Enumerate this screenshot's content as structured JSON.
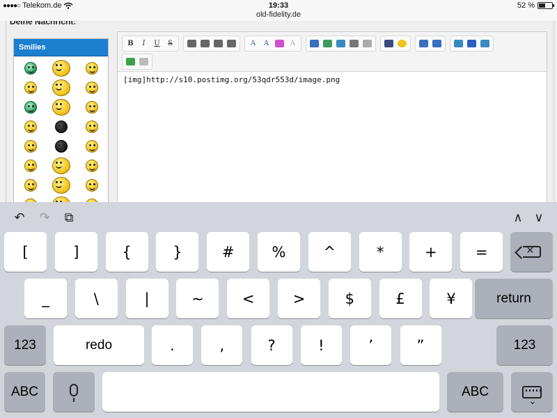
{
  "status_bar": {
    "carrier": "Telekom.de",
    "signal_dots": "●●●●○",
    "time": "19:33",
    "url": "old-fidelity.de",
    "battery_text": "52 %",
    "battery_level": 0.52
  },
  "page": {
    "section_title": "Deine Nachricht:",
    "smilies_title": "Smilies",
    "smilies_count": 24,
    "editor_content": "[img]http://s10.postimg.org/53qdr553d/image.png",
    "toolbar_row1_groups": [
      [
        {
          "label": "B",
          "name": "bold-button"
        },
        {
          "label": "I",
          "name": "italic-button"
        },
        {
          "label": "U",
          "name": "underline-button"
        },
        {
          "label": "S",
          "name": "strikethrough-button"
        }
      ],
      [
        {
          "label": "",
          "name": "align-left-icon"
        },
        {
          "label": "",
          "name": "align-center-icon"
        },
        {
          "label": "",
          "name": "align-right-icon"
        },
        {
          "label": "",
          "name": "align-justify-icon"
        }
      ],
      [
        {
          "label": "A",
          "name": "font-icon"
        },
        {
          "label": "A",
          "name": "font-size-icon"
        },
        {
          "label": "",
          "name": "color-grid-icon"
        },
        {
          "label": "A",
          "name": "remove-format-icon"
        }
      ],
      [
        {
          "label": "",
          "name": "horizontal-rule-icon"
        },
        {
          "label": "",
          "name": "image-icon"
        },
        {
          "label": "",
          "name": "email-icon"
        },
        {
          "label": "",
          "name": "link-icon"
        },
        {
          "label": "",
          "name": "unlink-icon"
        }
      ],
      [
        {
          "label": "",
          "name": "video-icon"
        },
        {
          "label": "",
          "name": "emoticon-icon"
        }
      ],
      [
        {
          "label": "",
          "name": "bullet-list-icon"
        },
        {
          "label": "",
          "name": "numbered-list-icon"
        }
      ],
      [
        {
          "label": "",
          "name": "quote-icon"
        },
        {
          "label": "",
          "name": "code-icon"
        },
        {
          "label": "",
          "name": "speech-bubble-icon"
        }
      ]
    ],
    "toolbar_row2_groups": [
      [
        {
          "label": "",
          "name": "source-mode-icon"
        },
        {
          "label": "",
          "name": "document-icon"
        }
      ]
    ]
  },
  "keyboard": {
    "row1": [
      "[",
      "]",
      "{",
      "}",
      "#",
      "%",
      "^",
      "*",
      "+",
      "="
    ],
    "row2": [
      "_",
      "\\",
      "|",
      "~",
      "<",
      ">",
      "$",
      "£",
      "¥"
    ],
    "row3": [
      ".",
      ",",
      "?",
      "!",
      "’",
      "”"
    ],
    "return_label": "return",
    "numbers_label": "123",
    "redo_label": "redo",
    "abc_label": "ABC",
    "undo_glyph": "↶",
    "redo_glyph": "↷",
    "paste_glyph": "⧉",
    "up_glyph": "∧",
    "down_glyph": "∨"
  }
}
